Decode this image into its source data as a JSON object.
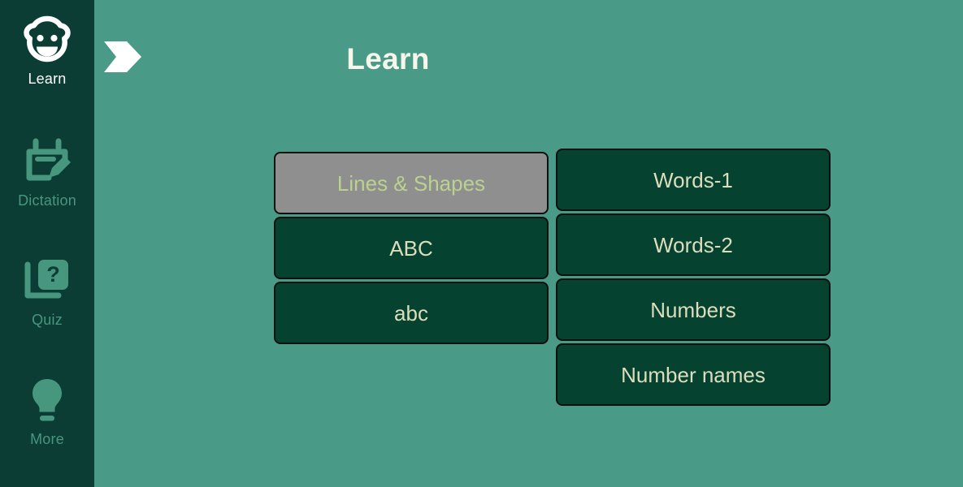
{
  "app": {
    "background_color": "#4a9a88",
    "sidebar_color": "#0b3d34",
    "tile_color": "#05422f",
    "tile_text_color": "#dcddbd",
    "tile_selected_color": "#8f8f8f",
    "tile_selected_text_color": "#bcd18f",
    "active_label_color": "#ffffff",
    "inactive_label_color": "#47977f"
  },
  "sidebar": {
    "items": [
      {
        "label": "Learn",
        "icon": "baby-face-icon",
        "active": true
      },
      {
        "label": "Dictation",
        "icon": "note-pencil-icon",
        "active": false
      },
      {
        "label": "Quiz",
        "icon": "question-card-icon",
        "active": false
      },
      {
        "label": "More",
        "icon": "lightbulb-icon",
        "active": false
      }
    ]
  },
  "header": {
    "title": "Learn",
    "flag_icon": "pennant-right-icon"
  },
  "main": {
    "columns": [
      {
        "name": "left",
        "tiles": [
          {
            "label": "Lines & Shapes",
            "selected": true
          },
          {
            "label": "ABC",
            "selected": false
          },
          {
            "label": "abc",
            "selected": false
          }
        ]
      },
      {
        "name": "right",
        "tiles": [
          {
            "label": "Words-1",
            "selected": false
          },
          {
            "label": "Words-2",
            "selected": false
          },
          {
            "label": "Numbers",
            "selected": false
          },
          {
            "label": "Number names",
            "selected": false
          }
        ]
      }
    ]
  }
}
